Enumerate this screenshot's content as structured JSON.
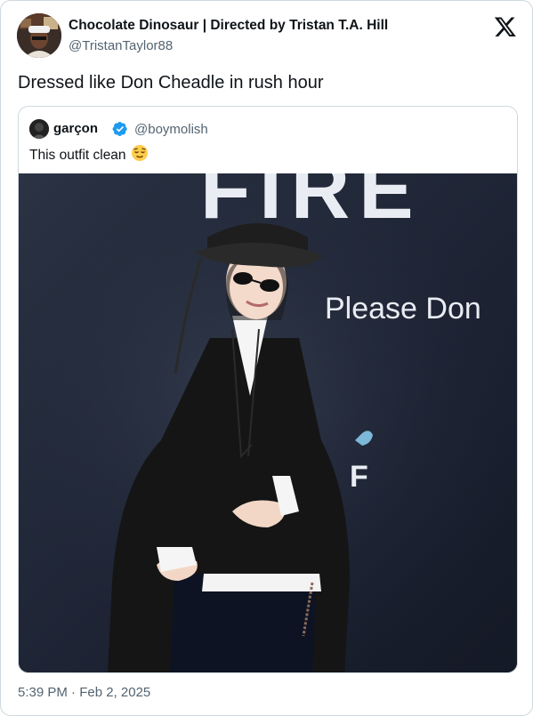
{
  "author": {
    "name": "Chocolate Dinosaur | Directed by Tristan T.A. Hill",
    "handle": "@TristanTaylor88",
    "avatar_icon": "avatar-photo"
  },
  "tweet": {
    "text": "Dressed like Don Cheadle in rush hour",
    "timestamp": "5:39 PM · Feb 2, 2025"
  },
  "quoted_tweet": {
    "name": "garçon",
    "handle": "@boymolish",
    "text": "This outfit clean",
    "emoji": "relieved-face-emoji",
    "verified_icon": "verified-badge-icon",
    "photo": {
      "backdrop_text_top": "FIRE",
      "backdrop_text_mid": "Please Don",
      "backdrop_text_low": "F"
    }
  },
  "logo": "x-logo",
  "colors": {
    "text": "#0f1419",
    "secondary": "#536471",
    "border": "#cfd9de",
    "verified": "#1d9bf0"
  }
}
